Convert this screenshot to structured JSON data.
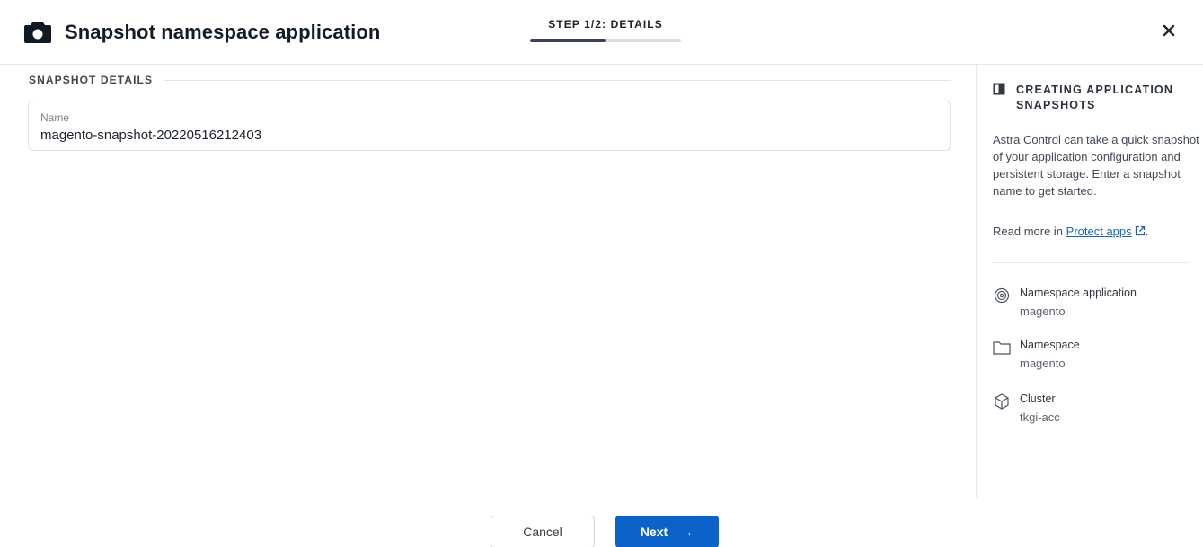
{
  "header": {
    "title": "Snapshot namespace application",
    "step_label": "STEP 1/2: DETAILS",
    "step_progress_fraction": 0.5,
    "close_icon": "close-icon",
    "title_icon": "camera-icon"
  },
  "form": {
    "section_title": "SNAPSHOT DETAILS",
    "name_label": "Name",
    "name_value": "magento-snapshot-20220516212403"
  },
  "sidebar": {
    "title": "CREATING APPLICATION SNAPSHOTS",
    "title_icon": "book-icon",
    "description": "Astra Control can take a quick snapshot of your application configuration and persistent storage. Enter a snapshot name to get started.",
    "read_more_prefix": "Read more in ",
    "read_more_link": "Protect apps",
    "read_more_suffix": ".",
    "items": [
      {
        "label": "Namespace application",
        "value": "magento",
        "icon": "namespace-application-icon"
      },
      {
        "label": "Namespace",
        "value": "magento",
        "icon": "folder-icon"
      },
      {
        "label": "Cluster",
        "value": "tkgi-acc",
        "icon": "cluster-icon"
      }
    ]
  },
  "footer": {
    "cancel_label": "Cancel",
    "next_label": "Next"
  },
  "colors": {
    "primary": "#0b63c9",
    "link": "#1565c0",
    "progress_fill": "#3a4450",
    "progress_track": "#d9dde2"
  }
}
